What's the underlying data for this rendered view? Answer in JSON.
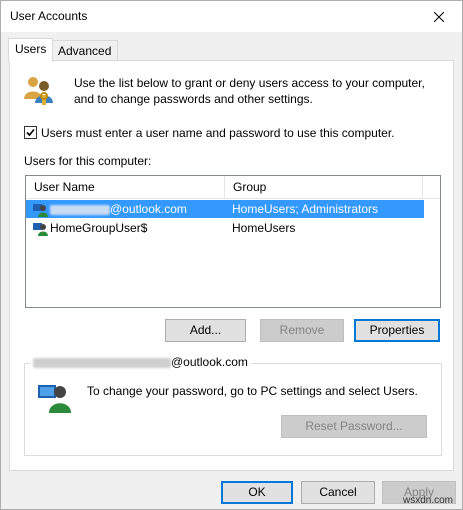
{
  "window": {
    "title": "User Accounts"
  },
  "tabs": [
    {
      "label": "Users",
      "active": true
    },
    {
      "label": "Advanced",
      "active": false
    }
  ],
  "intro": {
    "line1": "Use the list below to grant or deny users access to your computer,",
    "line2": "and to change passwords and other settings.",
    "icon": "users-icon"
  },
  "require_login": {
    "label": "Users must enter a user name and password to use this computer.",
    "checked": true
  },
  "users_section_label": "Users for this computer:",
  "users_table": {
    "columns": [
      "User Name",
      "Group"
    ],
    "rows": [
      {
        "user_suffix": "@outlook.com",
        "group": "HomeUsers; Administrators",
        "selected": true
      },
      {
        "user": "HomeGroupUser$",
        "group": "HomeUsers",
        "selected": false
      }
    ]
  },
  "list_buttons": {
    "add": "Add...",
    "remove": "Remove",
    "properties": "Properties"
  },
  "password_group": {
    "legend_suffix": "@outlook.com",
    "text": "To change your password, go to PC settings and select Users.",
    "reset_label": "Reset Password..."
  },
  "footer": {
    "ok": "OK",
    "cancel": "Cancel",
    "apply": "Apply"
  },
  "watermark": "wsxdn.com",
  "colors": {
    "selection": "#3399ff",
    "accent": "#0078d7"
  }
}
